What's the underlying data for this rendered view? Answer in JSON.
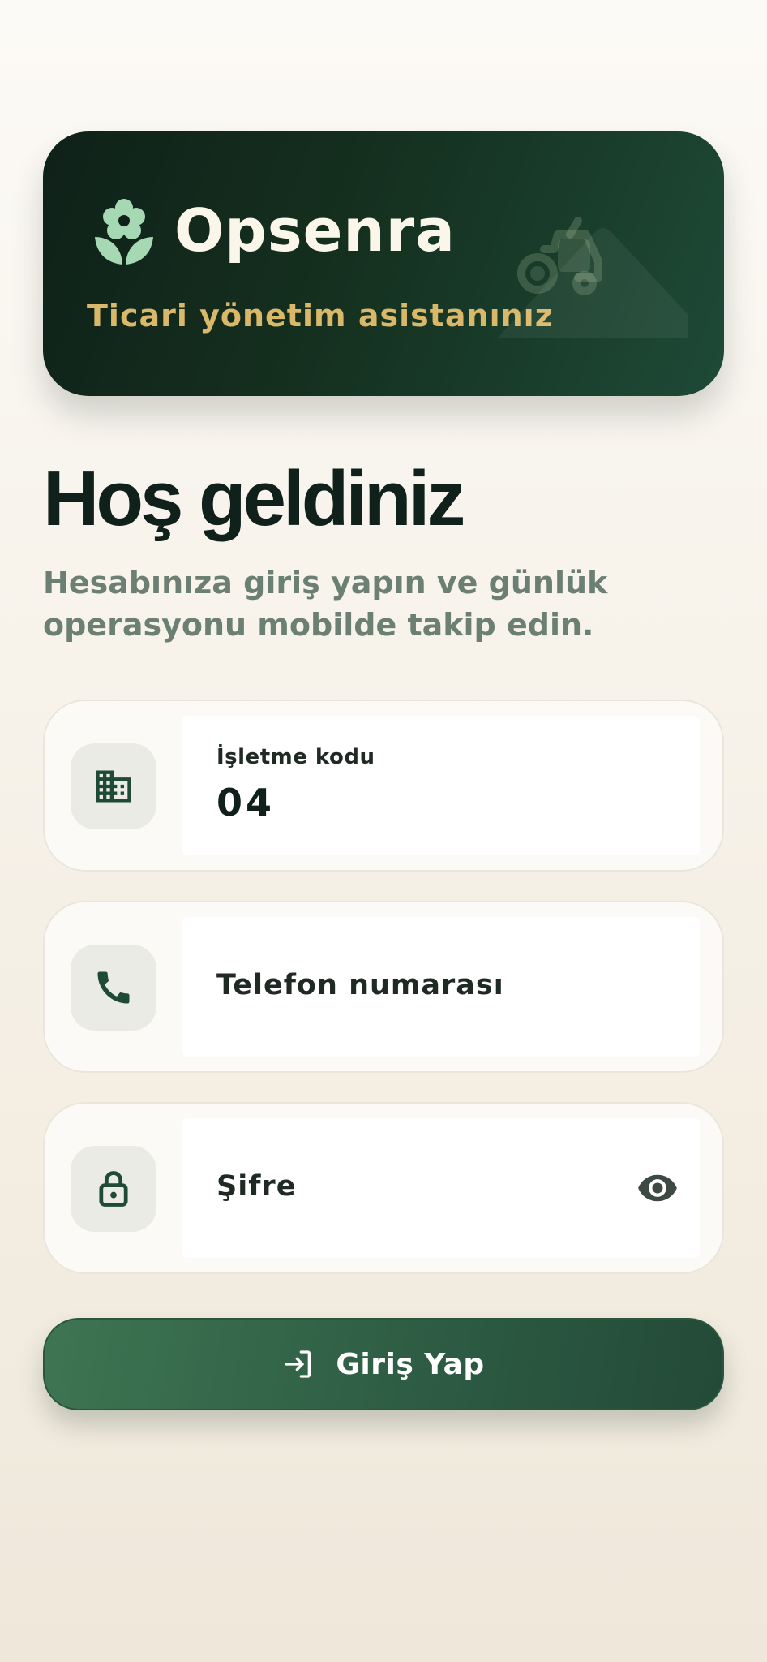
{
  "brand": {
    "name": "Opsenra",
    "tagline": "Ticari yönetim asistanınız",
    "logo_icon": "flower-icon",
    "illustration_icon": "tractor-icon"
  },
  "welcome": {
    "title": "Hoş geldiniz",
    "subtitle": "Hesabınıza giriş yapın ve günlük operasyonu mobilde takip edin."
  },
  "form": {
    "business_code": {
      "label": "İşletme kodu",
      "value": "04",
      "icon": "building-icon"
    },
    "phone": {
      "placeholder": "Telefon numarası",
      "icon": "phone-icon"
    },
    "password": {
      "placeholder": "Şifre",
      "icon": "lock-icon",
      "toggle_icon": "eye-icon"
    }
  },
  "login_button": {
    "label": "Giriş Yap",
    "icon": "login-icon"
  },
  "colors": {
    "brand_dark": "#0f2119",
    "brand_green": "#2c5a42",
    "accent_gold": "#d9b869",
    "icon_green": "#1f4a36"
  }
}
